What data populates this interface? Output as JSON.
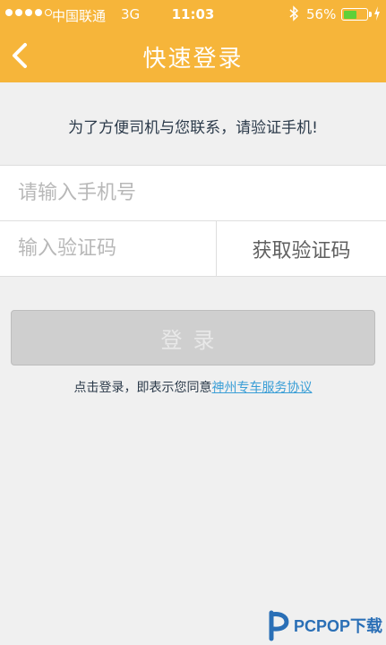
{
  "status_bar": {
    "carrier": "中国联通",
    "network": "3G",
    "time": "11:03",
    "battery_percent": "56%",
    "battery_level": 0.56,
    "bluetooth_icon": "bluetooth-icon",
    "charging_icon": "charging-icon"
  },
  "header": {
    "title": "快速登录",
    "back_icon": "chevron-left-icon"
  },
  "notice": "为了方便司机与您联系，请验证手机!",
  "form": {
    "phone_placeholder": "请输入手机号",
    "phone_value": "",
    "code_placeholder": "输入验证码",
    "code_value": "",
    "get_code_label": "获取验证码"
  },
  "login_button": "登录",
  "agreement": {
    "prefix": "点击登录，即表示您同意",
    "link": "神州专车服务协议"
  },
  "watermark": {
    "text": "PCPOP下载"
  },
  "colors": {
    "header": "#f6b53a",
    "link": "#3a9ed6",
    "button_disabled": "#cfcfcf",
    "background": "#f0f0f0"
  }
}
